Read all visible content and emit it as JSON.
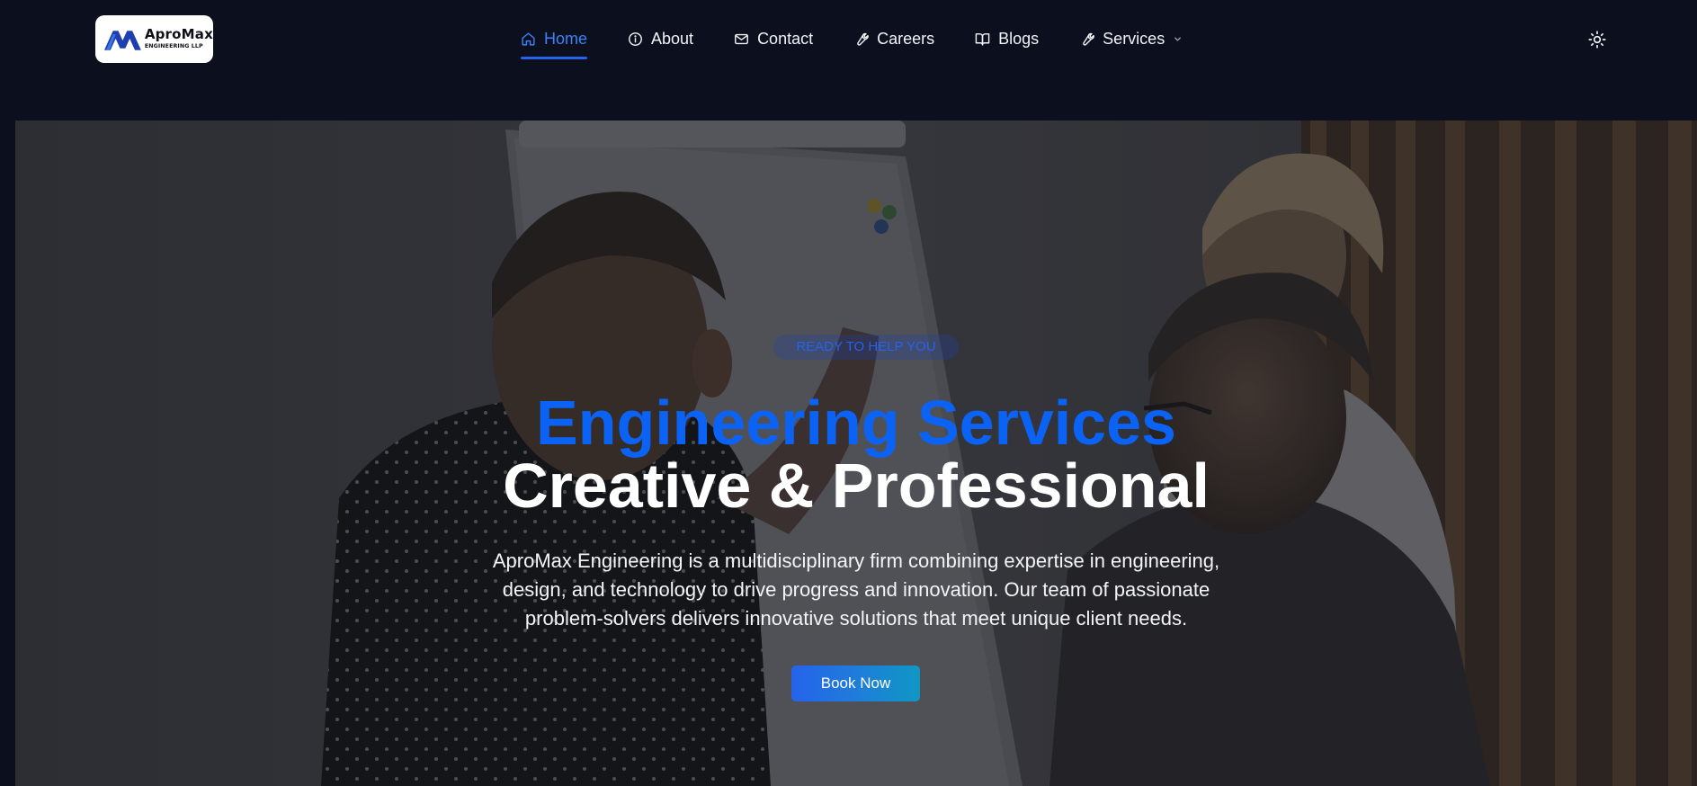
{
  "brand": {
    "name": "AproMax",
    "subtitle": "ENGINEERING LLP",
    "icon": "apromax-logo"
  },
  "nav": {
    "items": [
      {
        "label": "Home",
        "icon": "home-icon",
        "active": true
      },
      {
        "label": "About",
        "icon": "info-icon",
        "active": false
      },
      {
        "label": "Contact",
        "icon": "mail-icon",
        "active": false
      },
      {
        "label": "Careers",
        "icon": "wrench-icon",
        "active": false
      },
      {
        "label": "Blogs",
        "icon": "book-icon",
        "active": false
      },
      {
        "label": "Services",
        "icon": "wrench-icon",
        "active": false,
        "dropdown": true
      }
    ],
    "theme_toggle_icon": "sun-icon"
  },
  "hero": {
    "badge": "READY TO HELP YOU",
    "title_line1": "Engineering Services",
    "title_line2": "Creative & Professional",
    "description": "AproMax Engineering is a multidisciplinary firm combining expertise in engineering, design, and technology to drive progress and innovation. Our team of passionate problem-solvers delivers innovative solutions that meet unique client needs.",
    "cta_label": "Book Now"
  },
  "colors": {
    "page_bg": "#0b0f1e",
    "accent": "#2563eb",
    "title_blue": "#0b63f5"
  }
}
